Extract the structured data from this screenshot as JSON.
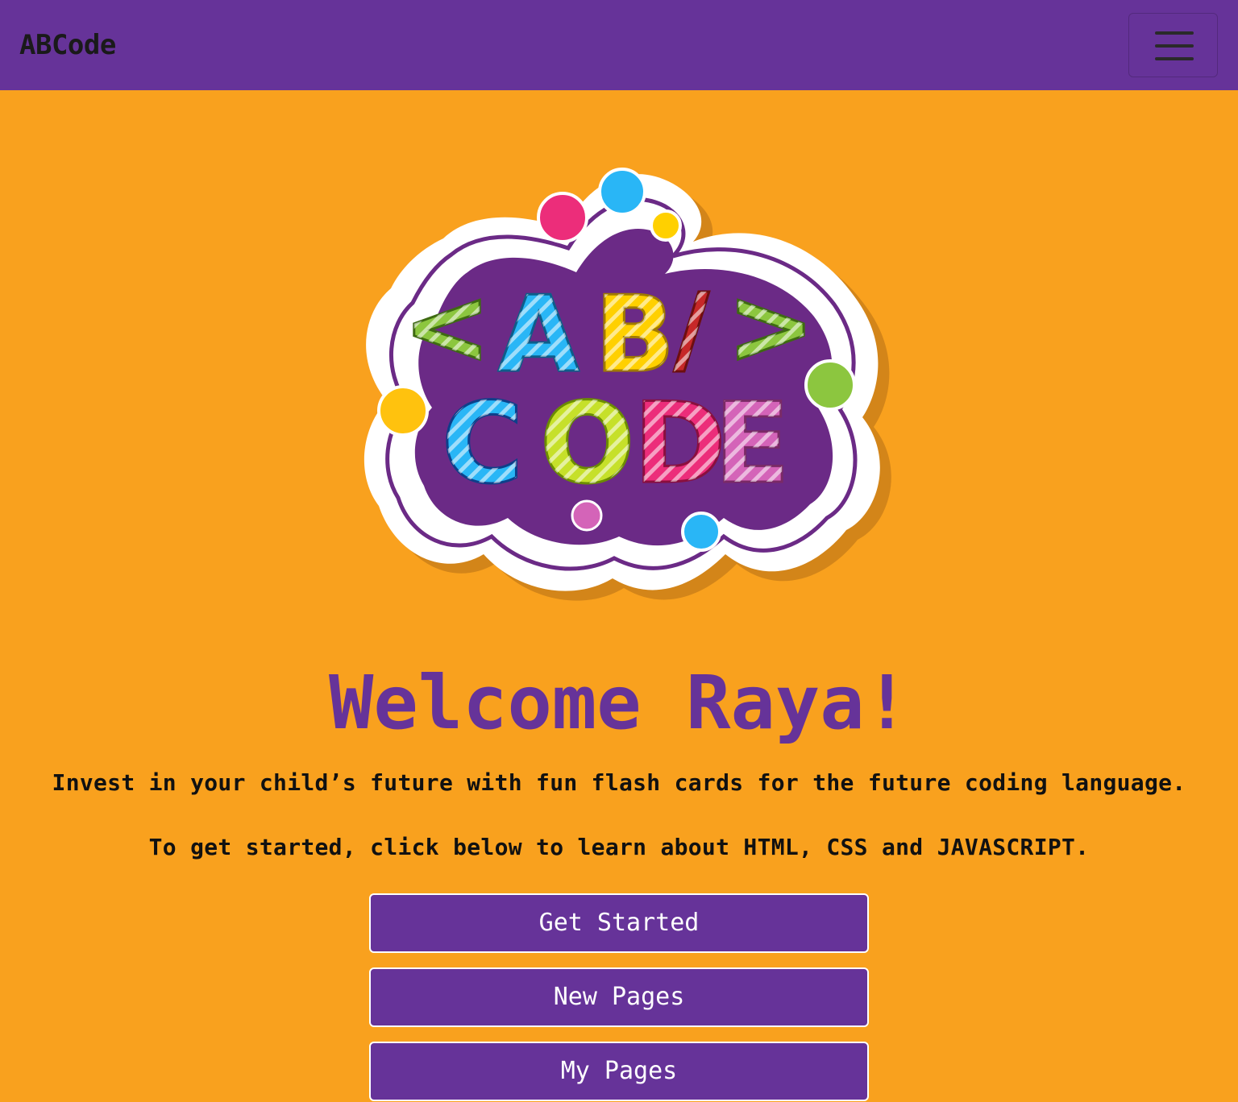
{
  "navbar": {
    "brand": "ABCode",
    "menu_icon": "hamburger-menu-icon"
  },
  "logo": {
    "line1": "<AB/>",
    "line2": "CODE",
    "colors": {
      "badge": "#6b2a86",
      "outline": "#ffffff",
      "green": "#8cc63f",
      "blue": "#29b6f6",
      "yellow": "#ffd000",
      "red": "#c62828",
      "pink": "#ec2d7a",
      "magenta": "#d464b8"
    }
  },
  "hero": {
    "title": "Welcome Raya!",
    "line1": "Invest in your child’s future with fun flash cards for the future coding language.",
    "line2": "To get started, click below to learn about HTML, CSS and JAVASCRIPT."
  },
  "buttons": {
    "get_started": "Get Started",
    "new_pages": "New Pages",
    "my_pages": "My Pages"
  },
  "theme": {
    "background": "#f9a11e",
    "primary": "#663399"
  }
}
